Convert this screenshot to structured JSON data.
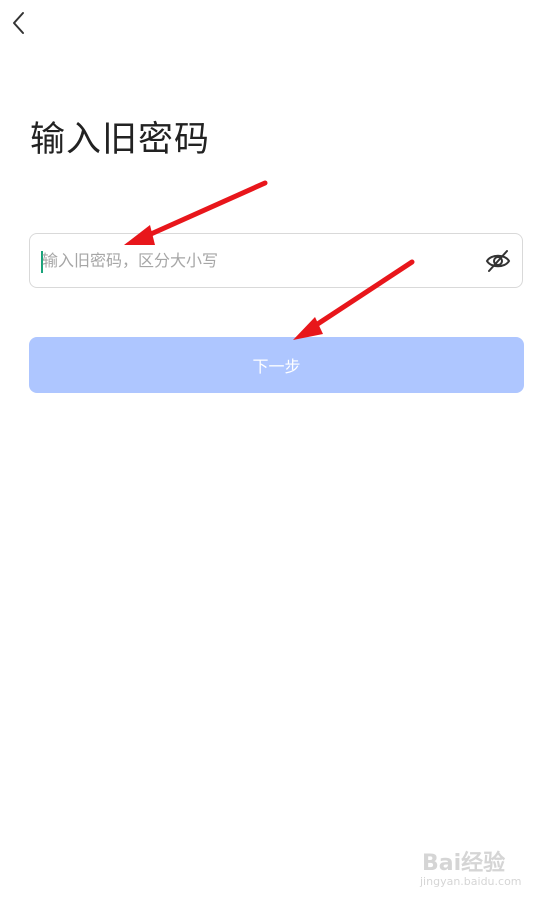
{
  "header": {
    "back_icon": "chevron-left-icon"
  },
  "page": {
    "title": "输入旧密码"
  },
  "password_field": {
    "value": "",
    "placeholder": "输入旧密码，区分大小写",
    "toggle_icon": "eye-off-icon"
  },
  "next_button": {
    "label": "下一步",
    "background": "#aec6ff",
    "text_color": "#ffffff"
  },
  "annotations": {
    "arrow_color": "#e8161b"
  },
  "watermark": {
    "logo_text": "Bai经验",
    "url_text": "jingyan.baidu.com"
  }
}
